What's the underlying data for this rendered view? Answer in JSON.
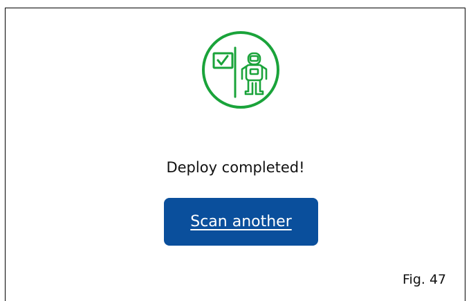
{
  "status": {
    "message": "Deploy completed!",
    "icon": "astronaut-flag-icon",
    "accent_color": "#1aa33a"
  },
  "actions": {
    "scan_another_label": "Scan another",
    "button_color": "#0a4f9c"
  },
  "caption": {
    "text": "Fig. 47"
  }
}
